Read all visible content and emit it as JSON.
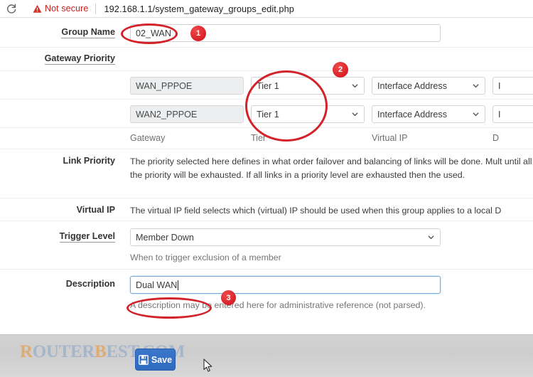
{
  "browser": {
    "reload_icon": "reload-icon",
    "warning_icon": "warning-triangle-icon",
    "security_label": "Not secure",
    "url": "192.168.1.1/system_gateway_groups_edit.php"
  },
  "form": {
    "group_name": {
      "label": "Group Name",
      "value": "02_WAN"
    },
    "gateway_priority": {
      "label": "Gateway Priority",
      "columns": [
        "Gateway",
        "Tier",
        "Virtual IP",
        "D"
      ],
      "rows": [
        {
          "gateway": "WAN_PPPOE",
          "tier": "Tier 1",
          "virtual_ip": "Interface Address",
          "description": "I"
        },
        {
          "gateway": "WAN2_PPPOE",
          "tier": "Tier 1",
          "virtual_ip": "Interface Address",
          "description": "I"
        }
      ]
    },
    "link_priority": {
      "label": "Link Priority",
      "text": "The priority selected here defines in what order failover and balancing of links will be done. Mult until all links in the priority will be exhausted. If all links in a priority level are exhausted then the used."
    },
    "virtual_ip": {
      "label": "Virtual IP",
      "text": "The virtual IP field selects which (virtual) IP should be used when this group applies to a local D"
    },
    "trigger_level": {
      "label": "Trigger Level",
      "value": "Member Down",
      "help": "When to trigger exclusion of a member"
    },
    "description": {
      "label": "Description",
      "value": "Dual WAN",
      "help": "A description may be entered here for administrative reference (not parsed)."
    }
  },
  "footer": {
    "save_label": "Save",
    "save_icon": "floppy-disk-icon",
    "cursor_icon": "mouse-pointer-icon",
    "watermark": {
      "part1": "R",
      "part2": "OUTER",
      "part3": "B",
      "part4": "EST.",
      "part5": "COM"
    }
  },
  "annotations": {
    "badge1": "1",
    "badge2": "2",
    "badge3": "3",
    "color": "#d3222a"
  }
}
